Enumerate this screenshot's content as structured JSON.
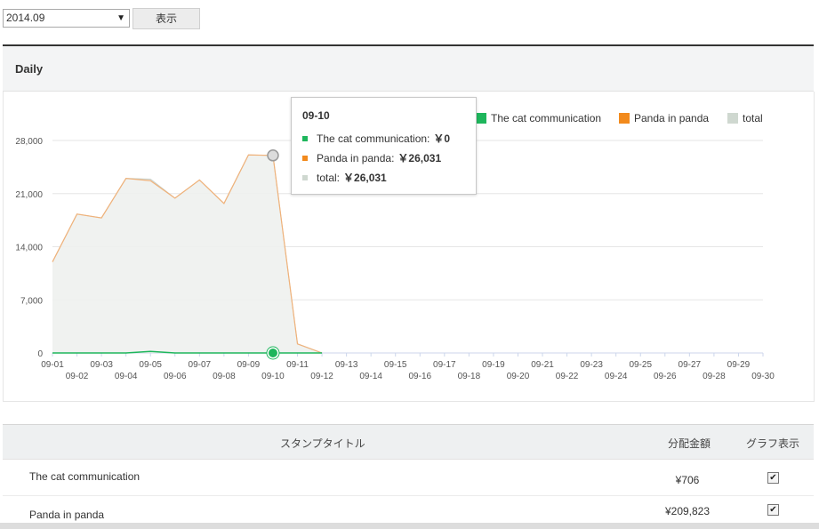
{
  "controls": {
    "month_select": "2014.09",
    "show_button": "表示"
  },
  "panel": {
    "title": "Daily"
  },
  "chart_data": {
    "type": "area",
    "x": [
      "09-01",
      "09-02",
      "09-03",
      "09-04",
      "09-05",
      "09-06",
      "09-07",
      "09-08",
      "09-09",
      "09-10",
      "09-11",
      "09-12",
      "09-13",
      "09-14",
      "09-15",
      "09-16",
      "09-17",
      "09-18",
      "09-19",
      "09-20",
      "09-21",
      "09-22",
      "09-23",
      "09-24",
      "09-25",
      "09-26",
      "09-27",
      "09-28",
      "09-29",
      "09-30"
    ],
    "series": [
      {
        "name": "The cat communication",
        "color": "#1eb65c",
        "values": [
          0,
          0,
          0,
          0,
          200,
          0,
          0,
          0,
          0,
          0,
          0,
          0,
          0,
          0,
          0,
          0,
          0,
          0,
          0,
          0,
          0,
          0,
          0,
          0,
          0,
          0,
          0,
          0,
          0,
          0
        ]
      },
      {
        "name": "Panda in panda",
        "color": "#f28a1d",
        "values": [
          12000,
          18300,
          17800,
          23000,
          22700,
          20400,
          22800,
          19700,
          26100,
          26031,
          1200,
          0,
          0,
          0,
          0,
          0,
          0,
          0,
          0,
          0,
          0,
          0,
          0,
          0,
          0,
          0,
          0,
          0,
          0,
          0
        ]
      },
      {
        "name": "total",
        "color": "#cfd8d0",
        "values": [
          12000,
          18300,
          17800,
          23000,
          22900,
          20400,
          22800,
          19700,
          26100,
          26031,
          1200,
          0,
          0,
          0,
          0,
          0,
          0,
          0,
          0,
          0,
          0,
          0,
          0,
          0,
          0,
          0,
          0,
          0,
          0,
          0
        ]
      }
    ],
    "y_ticks": [
      "0",
      "7,000",
      "14,000",
      "21,000",
      "28,000"
    ],
    "ylim": [
      0,
      28000
    ],
    "grid": true,
    "legend_position": "top-right",
    "tooltip": {
      "date": "09-10",
      "rows": [
        {
          "label": "The cat communication:",
          "value": "￥0",
          "color": "#1eb65c"
        },
        {
          "label": "Panda in panda:",
          "value": "￥26,031",
          "color": "#f28a1d"
        },
        {
          "label": "total:",
          "value": "￥26,031",
          "color": "#cfd8d0"
        }
      ]
    }
  },
  "legend": [
    {
      "label": "The cat communication",
      "color": "#1eb65c"
    },
    {
      "label": "Panda in panda",
      "color": "#f28a1d"
    },
    {
      "label": "total",
      "color": "#cfd8d0"
    }
  ],
  "table": {
    "headers": {
      "title": "スタンプタイトル",
      "amount": "分配金額",
      "graph": "グラフ表示"
    },
    "rows": [
      {
        "name": "The cat communication",
        "amount": "¥706",
        "checked": "✔"
      },
      {
        "name": "Panda in panda",
        "amount": "¥209,823",
        "checked": "✔"
      }
    ]
  }
}
